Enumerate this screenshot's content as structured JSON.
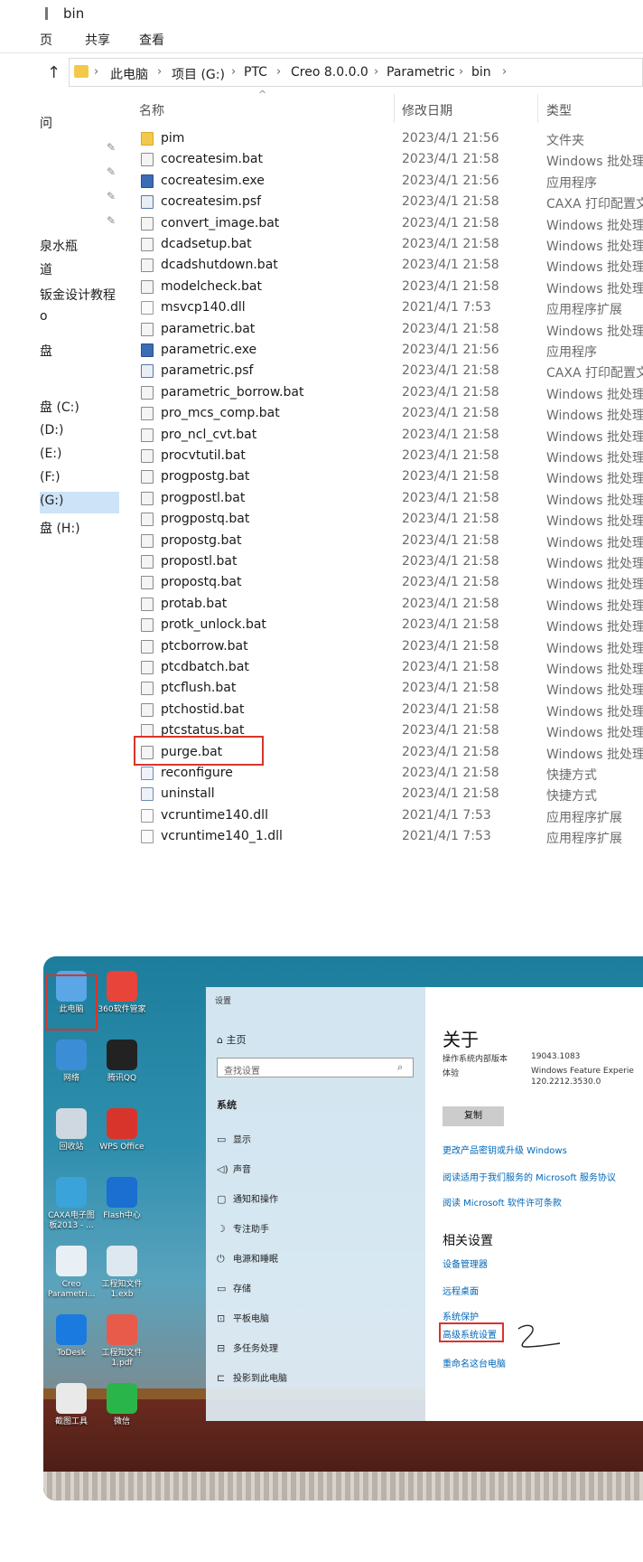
{
  "explorer": {
    "title": "bin",
    "ribbon_tabs": [
      "页",
      "共享",
      "查看"
    ],
    "address": [
      "此电脑",
      "项目 (G:)",
      "PTC",
      "Creo 8.0.0.0",
      "Parametric",
      "bin"
    ],
    "columns": {
      "name": "名称",
      "date": "修改日期",
      "type": "类型"
    },
    "nav": [
      "问",
      "泉水瓶",
      "道",
      "钣金设计教程",
      "o",
      "盘",
      "盘 (C:)",
      "(D:)",
      "(E:)",
      "(F:)",
      "(G:)",
      "盘 (H:)"
    ],
    "files": [
      {
        "name": "pim",
        "date": "2023/4/1 21:56",
        "type": "文件夹",
        "icon": "folder"
      },
      {
        "name": "cocreatesim.bat",
        "date": "2023/4/1 21:58",
        "type": "Windows 批处理...",
        "icon": "bat"
      },
      {
        "name": "cocreatesim.exe",
        "date": "2023/4/1 21:56",
        "type": "应用程序",
        "icon": "exe"
      },
      {
        "name": "cocreatesim.psf",
        "date": "2023/4/1 21:58",
        "type": "CAXA 打印配置文...",
        "icon": "psf"
      },
      {
        "name": "convert_image.bat",
        "date": "2023/4/1 21:58",
        "type": "Windows 批处理...",
        "icon": "bat"
      },
      {
        "name": "dcadsetup.bat",
        "date": "2023/4/1 21:58",
        "type": "Windows 批处理...",
        "icon": "bat"
      },
      {
        "name": "dcadshutdown.bat",
        "date": "2023/4/1 21:58",
        "type": "Windows 批处理...",
        "icon": "bat"
      },
      {
        "name": "modelcheck.bat",
        "date": "2023/4/1 21:58",
        "type": "Windows 批处理...",
        "icon": "bat"
      },
      {
        "name": "msvcp140.dll",
        "date": "2021/4/1 7:53",
        "type": "应用程序扩展",
        "icon": "dll"
      },
      {
        "name": "parametric.bat",
        "date": "2023/4/1 21:58",
        "type": "Windows 批处理...",
        "icon": "bat"
      },
      {
        "name": "parametric.exe",
        "date": "2023/4/1 21:56",
        "type": "应用程序",
        "icon": "exe"
      },
      {
        "name": "parametric.psf",
        "date": "2023/4/1 21:58",
        "type": "CAXA 打印配置文...",
        "icon": "psf"
      },
      {
        "name": "parametric_borrow.bat",
        "date": "2023/4/1 21:58",
        "type": "Windows 批处理...",
        "icon": "bat"
      },
      {
        "name": "pro_mcs_comp.bat",
        "date": "2023/4/1 21:58",
        "type": "Windows 批处理...",
        "icon": "bat"
      },
      {
        "name": "pro_ncl_cvt.bat",
        "date": "2023/4/1 21:58",
        "type": "Windows 批处理...",
        "icon": "bat"
      },
      {
        "name": "procvtutil.bat",
        "date": "2023/4/1 21:58",
        "type": "Windows 批处理...",
        "icon": "bat"
      },
      {
        "name": "progpostg.bat",
        "date": "2023/4/1 21:58",
        "type": "Windows 批处理...",
        "icon": "bat"
      },
      {
        "name": "progpostl.bat",
        "date": "2023/4/1 21:58",
        "type": "Windows 批处理...",
        "icon": "bat"
      },
      {
        "name": "progpostq.bat",
        "date": "2023/4/1 21:58",
        "type": "Windows 批处理...",
        "icon": "bat"
      },
      {
        "name": "propostg.bat",
        "date": "2023/4/1 21:58",
        "type": "Windows 批处理...",
        "icon": "bat"
      },
      {
        "name": "propostl.bat",
        "date": "2023/4/1 21:58",
        "type": "Windows 批处理...",
        "icon": "bat"
      },
      {
        "name": "propostq.bat",
        "date": "2023/4/1 21:58",
        "type": "Windows 批处理...",
        "icon": "bat"
      },
      {
        "name": "protab.bat",
        "date": "2023/4/1 21:58",
        "type": "Windows 批处理...",
        "icon": "bat"
      },
      {
        "name": "protk_unlock.bat",
        "date": "2023/4/1 21:58",
        "type": "Windows 批处理...",
        "icon": "bat"
      },
      {
        "name": "ptcborrow.bat",
        "date": "2023/4/1 21:58",
        "type": "Windows 批处理...",
        "icon": "bat"
      },
      {
        "name": "ptcdbatch.bat",
        "date": "2023/4/1 21:58",
        "type": "Windows 批处理...",
        "icon": "bat"
      },
      {
        "name": "ptcflush.bat",
        "date": "2023/4/1 21:58",
        "type": "Windows 批处理...",
        "icon": "bat"
      },
      {
        "name": "ptchostid.bat",
        "date": "2023/4/1 21:58",
        "type": "Windows 批处理...",
        "icon": "bat"
      },
      {
        "name": "ptcstatus.bat",
        "date": "2023/4/1 21:58",
        "type": "Windows 批处理...",
        "icon": "bat"
      },
      {
        "name": "purge.bat",
        "date": "2023/4/1 21:58",
        "type": "Windows 批处理...",
        "icon": "bat"
      },
      {
        "name": "reconfigure",
        "date": "2023/4/1 21:58",
        "type": "快捷方式",
        "icon": "lnk"
      },
      {
        "name": "uninstall",
        "date": "2023/4/1 21:58",
        "type": "快捷方式",
        "icon": "lnk"
      },
      {
        "name": "vcruntime140.dll",
        "date": "2021/4/1 7:53",
        "type": "应用程序扩展",
        "icon": "dll"
      },
      {
        "name": "vcruntime140_1.dll",
        "date": "2021/4/1 7:53",
        "type": "应用程序扩展",
        "icon": "dll"
      }
    ]
  },
  "desktop": {
    "icons": [
      {
        "label": "此电脑",
        "color": "#5aa6e6"
      },
      {
        "label": "360软件管家",
        "color": "#e8443a"
      },
      {
        "label": "网络",
        "color": "#3b8ed6"
      },
      {
        "label": "腾讯QQ",
        "color": "#222222"
      },
      {
        "label": "回收站",
        "color": "#cfd8e0"
      },
      {
        "label": "WPS Office",
        "color": "#d9342b"
      },
      {
        "label": "CAXA电子图板2013 - ...",
        "color": "#3aa3d9"
      },
      {
        "label": "Flash中心",
        "color": "#1a6fd1"
      },
      {
        "label": "Creo Parametri...",
        "color": "#e9f0f5"
      },
      {
        "label": "工程知文件1.exb",
        "color": "#dde8f0"
      },
      {
        "label": "ToDesk",
        "color": "#1a7ae0"
      },
      {
        "label": "工程知文件1.pdf",
        "color": "#e85a4a"
      },
      {
        "label": "截图工具",
        "color": "#e9e9e9"
      },
      {
        "label": "微信",
        "color": "#2ab54a"
      }
    ]
  },
  "settings": {
    "window_title": "设置",
    "home": "主页",
    "search_placeholder": "查找设置",
    "section": "系统",
    "nav": [
      {
        "icon": "▭",
        "label": "显示"
      },
      {
        "icon": "◁)",
        "label": "声音"
      },
      {
        "icon": "▢",
        "label": "通知和操作"
      },
      {
        "icon": "☽",
        "label": "专注助手"
      },
      {
        "icon": "⏻",
        "label": "电源和睡眠"
      },
      {
        "icon": "▭",
        "label": "存储"
      },
      {
        "icon": "⊡",
        "label": "平板电脑"
      },
      {
        "icon": "⊟",
        "label": "多任务处理"
      },
      {
        "icon": "⊏",
        "label": "投影到此电脑"
      }
    ],
    "about_title": "关于",
    "spec": [
      {
        "k": "操作系统内部版本",
        "v": "19043.1083"
      },
      {
        "k": "体验",
        "v": "Windows Feature Experie"
      },
      {
        "k": "",
        "v": "120.2212.3530.0"
      }
    ],
    "copy_button": "复制",
    "links": [
      "更改产品密钥或升级 Windows",
      "阅读适用于我们服务的 Microsoft 服务协议",
      "阅读 Microsoft 软件许可条款"
    ],
    "related_title": "相关设置",
    "related_links": [
      "设备管理器",
      "远程桌面",
      "系统保护",
      "高级系统设置",
      "重命名这台电脑"
    ]
  }
}
